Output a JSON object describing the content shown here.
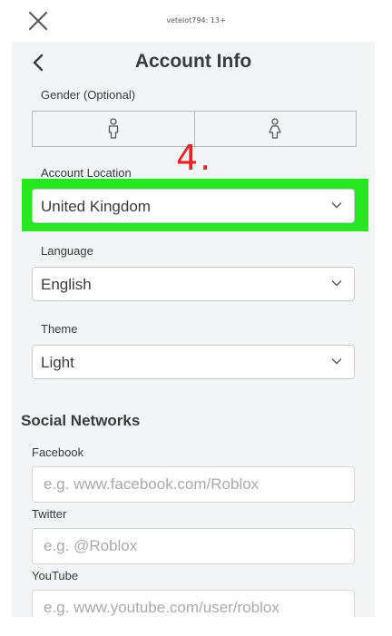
{
  "header": {
    "username": "vetelot794: 13+"
  },
  "page": {
    "title": "Account Info"
  },
  "gender": {
    "label": "Gender (Optional)",
    "options": [
      "male-icon",
      "female-icon"
    ]
  },
  "annotation": {
    "text": "4.",
    "color": "#e8202a"
  },
  "highlight_color": "#26e61e",
  "account_location": {
    "label": "Account Location",
    "value": "United Kingdom"
  },
  "language": {
    "label": "Language",
    "value": "English"
  },
  "theme": {
    "label": "Theme",
    "value": "Light"
  },
  "social_networks": {
    "title": "Social Networks",
    "facebook": {
      "label": "Facebook",
      "placeholder": "e.g. www.facebook.com/Roblox"
    },
    "twitter": {
      "label": "Twitter",
      "placeholder": "e.g. @Roblox"
    },
    "youtube": {
      "label": "YouTube",
      "placeholder": "e.g. www.youtube.com/user/roblox"
    }
  }
}
